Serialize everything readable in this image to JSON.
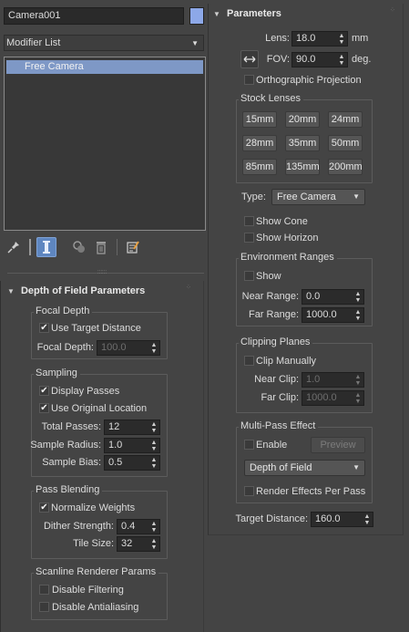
{
  "left": {
    "object_name": "Camera001",
    "color_swatch": "#8da8e8",
    "modifier_list": "Modifier List",
    "stack_items": [
      "Free Camera"
    ],
    "toolbar_icons": [
      "pin-stack-icon",
      "show-end-result-icon",
      "make-unique-icon",
      "remove-modifier-icon",
      "configure-modifier-sets-icon"
    ]
  },
  "dof": {
    "title": "Depth of Field Parameters",
    "focal_depth": {
      "group": "Focal Depth",
      "use_target_label": "Use Target Distance",
      "use_target_checked": true,
      "focal_depth_label": "Focal Depth:",
      "focal_depth_value": "100.0"
    },
    "sampling": {
      "group": "Sampling",
      "display_passes_label": "Display Passes",
      "display_passes_checked": true,
      "use_original_label": "Use Original Location",
      "use_original_checked": true,
      "total_passes_label": "Total Passes:",
      "total_passes_value": "12",
      "sample_radius_label": "Sample Radius:",
      "sample_radius_value": "1.0",
      "sample_bias_label": "Sample Bias:",
      "sample_bias_value": "0.5"
    },
    "pass_blending": {
      "group": "Pass Blending",
      "normalize_label": "Normalize Weights",
      "normalize_checked": true,
      "dither_label": "Dither Strength:",
      "dither_value": "0.4",
      "tile_label": "Tile Size:",
      "tile_value": "32"
    },
    "scanline": {
      "group": "Scanline Renderer Params",
      "disable_filtering_label": "Disable Filtering",
      "disable_filtering_checked": false,
      "disable_aa_label": "Disable Antialiasing",
      "disable_aa_checked": false
    }
  },
  "params": {
    "title": "Parameters",
    "lens_label": "Lens:",
    "lens_value": "18.0",
    "lens_unit": "mm",
    "fov_label": "FOV:",
    "fov_value": "90.0",
    "fov_unit": "deg.",
    "fov_direction_icon": "horizontal-arrows-icon",
    "ortho_label": "Orthographic Projection",
    "ortho_checked": false,
    "stock_lenses": {
      "group": "Stock Lenses",
      "buttons": [
        "15mm",
        "20mm",
        "24mm",
        "28mm",
        "35mm",
        "50mm",
        "85mm",
        "135mm",
        "200mm"
      ]
    },
    "type_label": "Type:",
    "type_value": "Free Camera",
    "show_cone_label": "Show Cone",
    "show_cone_checked": false,
    "show_horizon_label": "Show Horizon",
    "show_horizon_checked": false,
    "env_ranges": {
      "group": "Environment Ranges",
      "show_label": "Show",
      "show_checked": false,
      "near_label": "Near Range:",
      "near_value": "0.0",
      "far_label": "Far Range:",
      "far_value": "1000.0"
    },
    "clipping": {
      "group": "Clipping Planes",
      "clip_manually_label": "Clip Manually",
      "clip_manually_checked": false,
      "near_clip_label": "Near Clip:",
      "near_clip_value": "1.0",
      "far_clip_label": "Far Clip:",
      "far_clip_value": "1000.0"
    },
    "multipass": {
      "group": "Multi-Pass Effect",
      "enable_label": "Enable",
      "enable_checked": false,
      "preview_label": "Preview",
      "effect_value": "Depth of Field",
      "render_per_pass_label": "Render Effects Per Pass",
      "render_per_pass_checked": false
    },
    "target_distance_label": "Target Distance:",
    "target_distance_value": "160.0"
  }
}
